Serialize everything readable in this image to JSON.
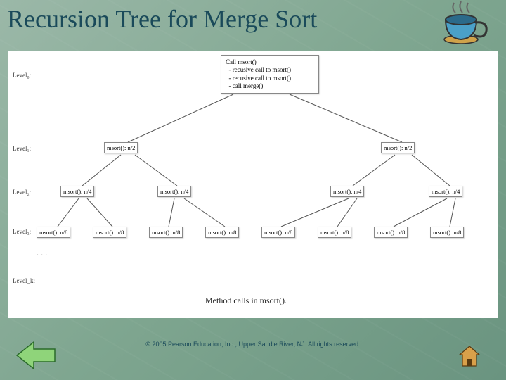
{
  "title": "Recursion Tree for Merge Sort",
  "copyright": "© 2005 Pearson Education, Inc., Upper Saddle River, NJ.  All rights reserved.",
  "caption": "Method calls in msort().",
  "ellipsis": ". . .",
  "levels": {
    "l0": "Level₀:",
    "l1": "Level₁:",
    "l2": "Level₂:",
    "l3": "Level₃:",
    "lk": "Level_k:"
  },
  "root": "Call msort()\n  - recusive call to msort()\n  - recusive call to msort()\n  - call merge()",
  "nodes": {
    "n2a": "msort(): n/2",
    "n2b": "msort(): n/2",
    "n4a": "msort(): n/4",
    "n4b": "msort(): n/4",
    "n4c": "msort(): n/4",
    "n4d": "msort(): n/4",
    "n8a": "msort(): n/8",
    "n8b": "msort(): n/8",
    "n8c": "msort(): n/8",
    "n8d": "msort(): n/8",
    "n8e": "msort(): n/8",
    "n8f": "msort(): n/8",
    "n8g": "msort(): n/8",
    "n8h": "msort(): n/8"
  },
  "icons": {
    "cup": "cup-icon",
    "back": "back-arrow-icon",
    "home": "home-icon"
  },
  "chart_data": {
    "type": "tree",
    "title": "Recursion Tree for Merge Sort",
    "root": {
      "label": "Call msort()",
      "detail": [
        "recusive call to msort()",
        "recusive call to msort()",
        "call merge()"
      ],
      "level": 0,
      "children": [
        {
          "label": "msort(): n/2",
          "level": 1,
          "children": [
            {
              "label": "msort(): n/4",
              "level": 2,
              "children": [
                {
                  "label": "msort(): n/8",
                  "level": 3
                },
                {
                  "label": "msort(): n/8",
                  "level": 3
                }
              ]
            },
            {
              "label": "msort(): n/4",
              "level": 2,
              "children": [
                {
                  "label": "msort(): n/8",
                  "level": 3
                },
                {
                  "label": "msort(): n/8",
                  "level": 3
                }
              ]
            }
          ]
        },
        {
          "label": "msort(): n/2",
          "level": 1,
          "children": [
            {
              "label": "msort(): n/4",
              "level": 2,
              "children": [
                {
                  "label": "msort(): n/8",
                  "level": 3
                },
                {
                  "label": "msort(): n/8",
                  "level": 3
                }
              ]
            },
            {
              "label": "msort(): n/4",
              "level": 2,
              "children": [
                {
                  "label": "msort(): n/8",
                  "level": 3
                },
                {
                  "label": "msort(): n/8",
                  "level": 3
                }
              ]
            }
          ]
        }
      ]
    },
    "level_labels": [
      "Level0",
      "Level1",
      "Level2",
      "Level3",
      "Levelk"
    ],
    "caption": "Method calls in msort()."
  }
}
